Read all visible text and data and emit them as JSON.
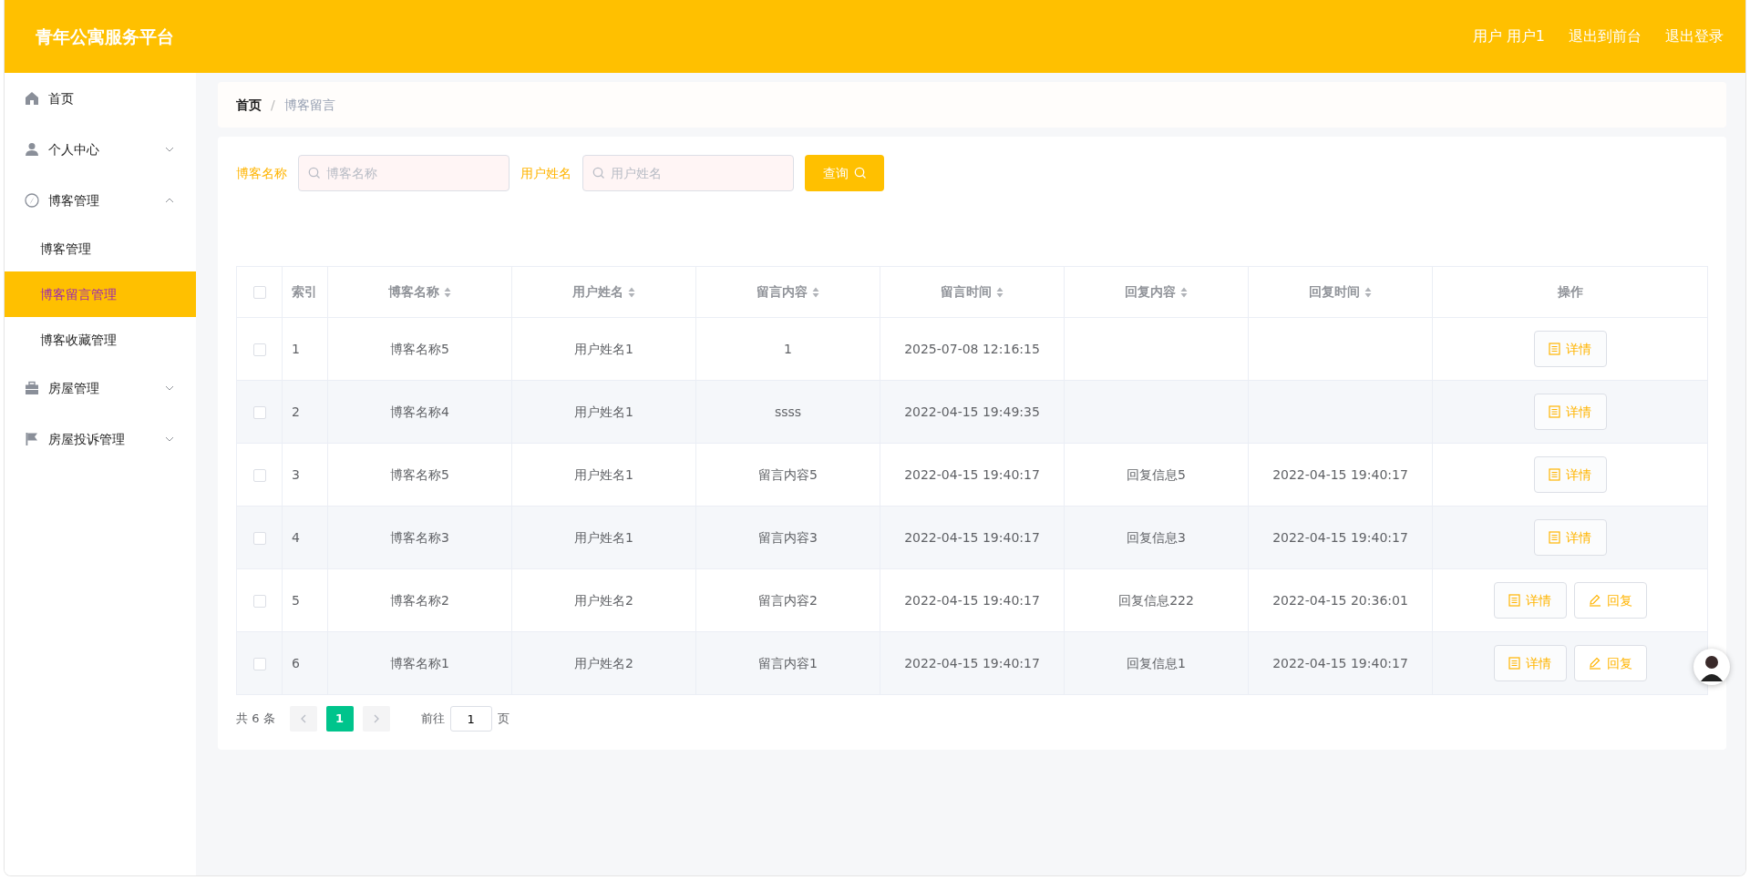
{
  "header": {
    "title": "青年公寓服务平台",
    "links": [
      "用户 用户1",
      "退出到前台",
      "退出登录"
    ]
  },
  "sidebar": {
    "items": [
      {
        "label": "首页",
        "kind": "link"
      },
      {
        "label": "个人中心",
        "kind": "group",
        "expanded": false
      },
      {
        "label": "博客管理",
        "kind": "group",
        "expanded": true,
        "children": [
          {
            "label": "博客管理",
            "selected": false
          },
          {
            "label": "博客留言管理",
            "selected": true
          },
          {
            "label": "博客收藏管理",
            "selected": false
          }
        ]
      },
      {
        "label": "房屋管理",
        "kind": "group",
        "expanded": false
      },
      {
        "label": "房屋投诉管理",
        "kind": "group",
        "expanded": false
      }
    ]
  },
  "breadcrumb": {
    "items": [
      "首页",
      "博客留言"
    ],
    "separator": "/"
  },
  "search": {
    "fields": [
      {
        "label": "博客名称",
        "placeholder": "博客名称"
      },
      {
        "label": "用户姓名",
        "placeholder": "用户姓名"
      }
    ],
    "button": "查询"
  },
  "table": {
    "header_checked": false,
    "columns": [
      {
        "label": "索引",
        "sortable": false
      },
      {
        "label": "博客名称",
        "sortable": true
      },
      {
        "label": "用户姓名",
        "sortable": true
      },
      {
        "label": "留言内容",
        "sortable": true
      },
      {
        "label": "留言时间",
        "sortable": true
      },
      {
        "label": "回复内容",
        "sortable": true
      },
      {
        "label": "回复时间",
        "sortable": true
      },
      {
        "label": "操作",
        "sortable": false
      }
    ],
    "rows": [
      {
        "checked": false,
        "cells": [
          "1",
          "博客名称5",
          "用户姓名1",
          "1",
          "2025-07-08 12:16:15",
          "",
          ""
        ],
        "actions": [
          {
            "kind": "detail",
            "label": "详情"
          }
        ]
      },
      {
        "checked": false,
        "cells": [
          "2",
          "博客名称4",
          "用户姓名1",
          "ssss",
          "2022-04-15 19:49:35",
          "",
          ""
        ],
        "actions": [
          {
            "kind": "detail",
            "label": "详情"
          }
        ]
      },
      {
        "checked": false,
        "cells": [
          "3",
          "博客名称5",
          "用户姓名1",
          "留言内容5",
          "2022-04-15 19:40:17",
          "回复信息5",
          "2022-04-15 19:40:17"
        ],
        "actions": [
          {
            "kind": "detail",
            "label": "详情"
          }
        ]
      },
      {
        "checked": false,
        "cells": [
          "4",
          "博客名称3",
          "用户姓名1",
          "留言内容3",
          "2022-04-15 19:40:17",
          "回复信息3",
          "2022-04-15 19:40:17"
        ],
        "actions": [
          {
            "kind": "detail",
            "label": "详情"
          }
        ]
      },
      {
        "checked": false,
        "cells": [
          "5",
          "博客名称2",
          "用户姓名2",
          "留言内容2",
          "2022-04-15 19:40:17",
          "回复信息222",
          "2022-04-15 20:36:01"
        ],
        "actions": [
          {
            "kind": "detail",
            "label": "详情"
          },
          {
            "kind": "reply",
            "label": "回复"
          }
        ]
      },
      {
        "checked": false,
        "cells": [
          "6",
          "博客名称1",
          "用户姓名2",
          "留言内容1",
          "2022-04-15 19:40:17",
          "回复信息1",
          "2022-04-15 19:40:17"
        ],
        "actions": [
          {
            "kind": "detail",
            "label": "详情"
          },
          {
            "kind": "reply",
            "label": "回复"
          }
        ]
      }
    ]
  },
  "pagination": {
    "total": "共 6 条",
    "pages": [
      {
        "label": "1",
        "selected": true
      }
    ],
    "goto_label": "前往",
    "goto_value": "1",
    "page_suffix": "页"
  }
}
